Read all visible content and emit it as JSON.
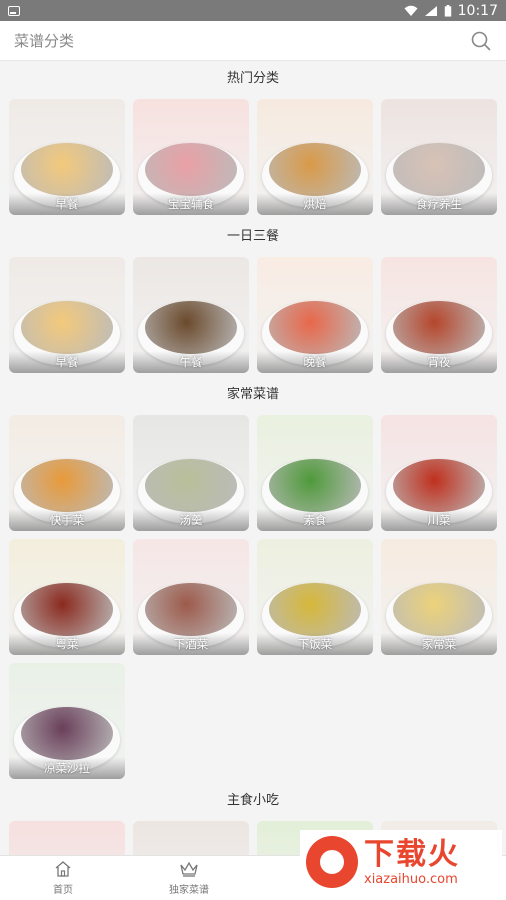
{
  "status_bar": {
    "time": "10:17"
  },
  "header": {
    "title": "菜谱分类"
  },
  "sections": [
    {
      "title": "热门分类",
      "items": [
        {
          "label": "早餐",
          "bg": "#efeae6",
          "dish": "#f3c97b"
        },
        {
          "label": "宝宝辅食",
          "bg": "#f7e1df",
          "dish": "#e9a0a5"
        },
        {
          "label": "烘焙",
          "bg": "#f6eadf",
          "dish": "#d99a48"
        },
        {
          "label": "食疗养生",
          "bg": "#ede3e0",
          "dish": "#d8c2b6"
        }
      ]
    },
    {
      "title": "一日三餐",
      "items": [
        {
          "label": "早餐",
          "bg": "#efeae6",
          "dish": "#f3c97b"
        },
        {
          "label": "午餐",
          "bg": "#ece7e4",
          "dish": "#6b4a2c"
        },
        {
          "label": "晚餐",
          "bg": "#f8ece3",
          "dish": "#e8674a"
        },
        {
          "label": "宵夜",
          "bg": "#f7e4e1",
          "dish": "#b5462c"
        }
      ]
    },
    {
      "title": "家常菜谱",
      "items": [
        {
          "label": "快手菜",
          "bg": "#f3ece4",
          "dish": "#e89a3a"
        },
        {
          "label": "汤羹",
          "bg": "#e6e6e4",
          "dish": "#b9bf9a"
        },
        {
          "label": "素食",
          "bg": "#e9f1df",
          "dish": "#4f9a3a"
        },
        {
          "label": "川菜",
          "bg": "#f6e3e3",
          "dish": "#c0301e"
        },
        {
          "label": "粤菜",
          "bg": "#f3eedc",
          "dish": "#8b2a1e"
        },
        {
          "label": "下酒菜",
          "bg": "#f6e6e6",
          "dish": "#9d5a4b"
        },
        {
          "label": "下饭菜",
          "bg": "#edf0e0",
          "dish": "#d6b83a"
        },
        {
          "label": "家常菜",
          "bg": "#f6ebe0",
          "dish": "#ecd27a"
        },
        {
          "label": "凉菜沙拉",
          "bg": "#e9f1e7",
          "dish": "#6a3f5a"
        }
      ]
    },
    {
      "title": "主食小吃",
      "items": [
        {
          "label": "",
          "bg": "#f6dfdf",
          "dish": "#f6dfdf"
        },
        {
          "label": "",
          "bg": "#ece6e2",
          "dish": "#ece6e2"
        },
        {
          "label": "",
          "bg": "#e3efd8",
          "dish": "#e3efd8"
        },
        {
          "label": "",
          "bg": "#f1ece6",
          "dish": "#f1ece6"
        }
      ]
    }
  ],
  "bottom_nav": [
    {
      "label": "首页",
      "icon": "home-icon"
    },
    {
      "label": "独家菜谱",
      "icon": "crown-icon"
    },
    {
      "label": "",
      "icon": ""
    },
    {
      "label": "",
      "icon": ""
    }
  ],
  "watermark": {
    "text": "下载火",
    "url": "xiazaihuo.com"
  }
}
